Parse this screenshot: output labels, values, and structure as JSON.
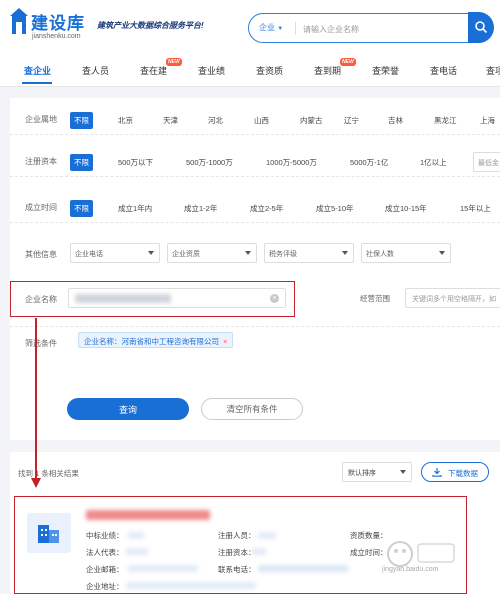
{
  "header": {
    "logo_name": "建设库",
    "logo_domain": "jianshenku.com",
    "slogan": "建筑产业大数据综合服务平台!",
    "search_type": "企业",
    "search_placeholder": "请输入企业名称"
  },
  "nav": {
    "tabs": [
      {
        "label": "查企业"
      },
      {
        "label": "查人员"
      },
      {
        "label": "查在建"
      },
      {
        "label": "查业绩"
      },
      {
        "label": "查资质"
      },
      {
        "label": "查到期"
      },
      {
        "label": "查荣誉"
      },
      {
        "label": "查电话"
      },
      {
        "label": "查项"
      }
    ],
    "new_badge": "NEW"
  },
  "filter": {
    "region": {
      "label": "企业属地",
      "options": [
        "不限",
        "北京",
        "天津",
        "河北",
        "山西",
        "内蒙古",
        "辽宁",
        "吉林",
        "黑龙江",
        "上海"
      ]
    },
    "capital": {
      "label": "注册资本",
      "options": [
        "不限",
        "500万以下",
        "500万-1000万",
        "1000万-5000万",
        "5000万-1亿",
        "1亿以上"
      ],
      "custom_placeholder": "最低金"
    },
    "founded": {
      "label": "成立时间",
      "options": [
        "不限",
        "成立1年内",
        "成立1-2年",
        "成立2-5年",
        "成立5-10年",
        "成立10-15年",
        "15年以上"
      ]
    },
    "other": {
      "label": "其他信息",
      "dropdowns": [
        "企业电话",
        "企业资质",
        "税务评级",
        "社保人数"
      ]
    },
    "company_name": {
      "label": "企业名称"
    },
    "scope": {
      "label": "经营范围",
      "placeholder": "关键词多个用空格隔开，如"
    },
    "conditions": {
      "label": "筛选条件",
      "tag_text": "企业名称：河南省和中工程咨询有限公司",
      "tag_close": "×"
    },
    "query_label": "查询",
    "clear_label": "清空所有条件"
  },
  "results": {
    "found_text": "找到 1 条相关结果",
    "sort_value": "默认排序",
    "download_label": "下载数据",
    "card": {
      "fields": [
        {
          "label": "中标业绩："
        },
        {
          "label": "注册人员："
        },
        {
          "label": "资质数量："
        },
        {
          "label": "法人代表："
        },
        {
          "label": "注册资本："
        },
        {
          "label": "成立时间："
        },
        {
          "label": "企业邮箱："
        },
        {
          "label": "联系电话："
        },
        {
          "label": "企业地址："
        }
      ]
    }
  },
  "watermark": {
    "domain": "jingyan.baidu.com"
  },
  "colors": {
    "accent": "#1a6fd6",
    "annotation": "#c0242a",
    "badge": "#ff5a3c"
  }
}
